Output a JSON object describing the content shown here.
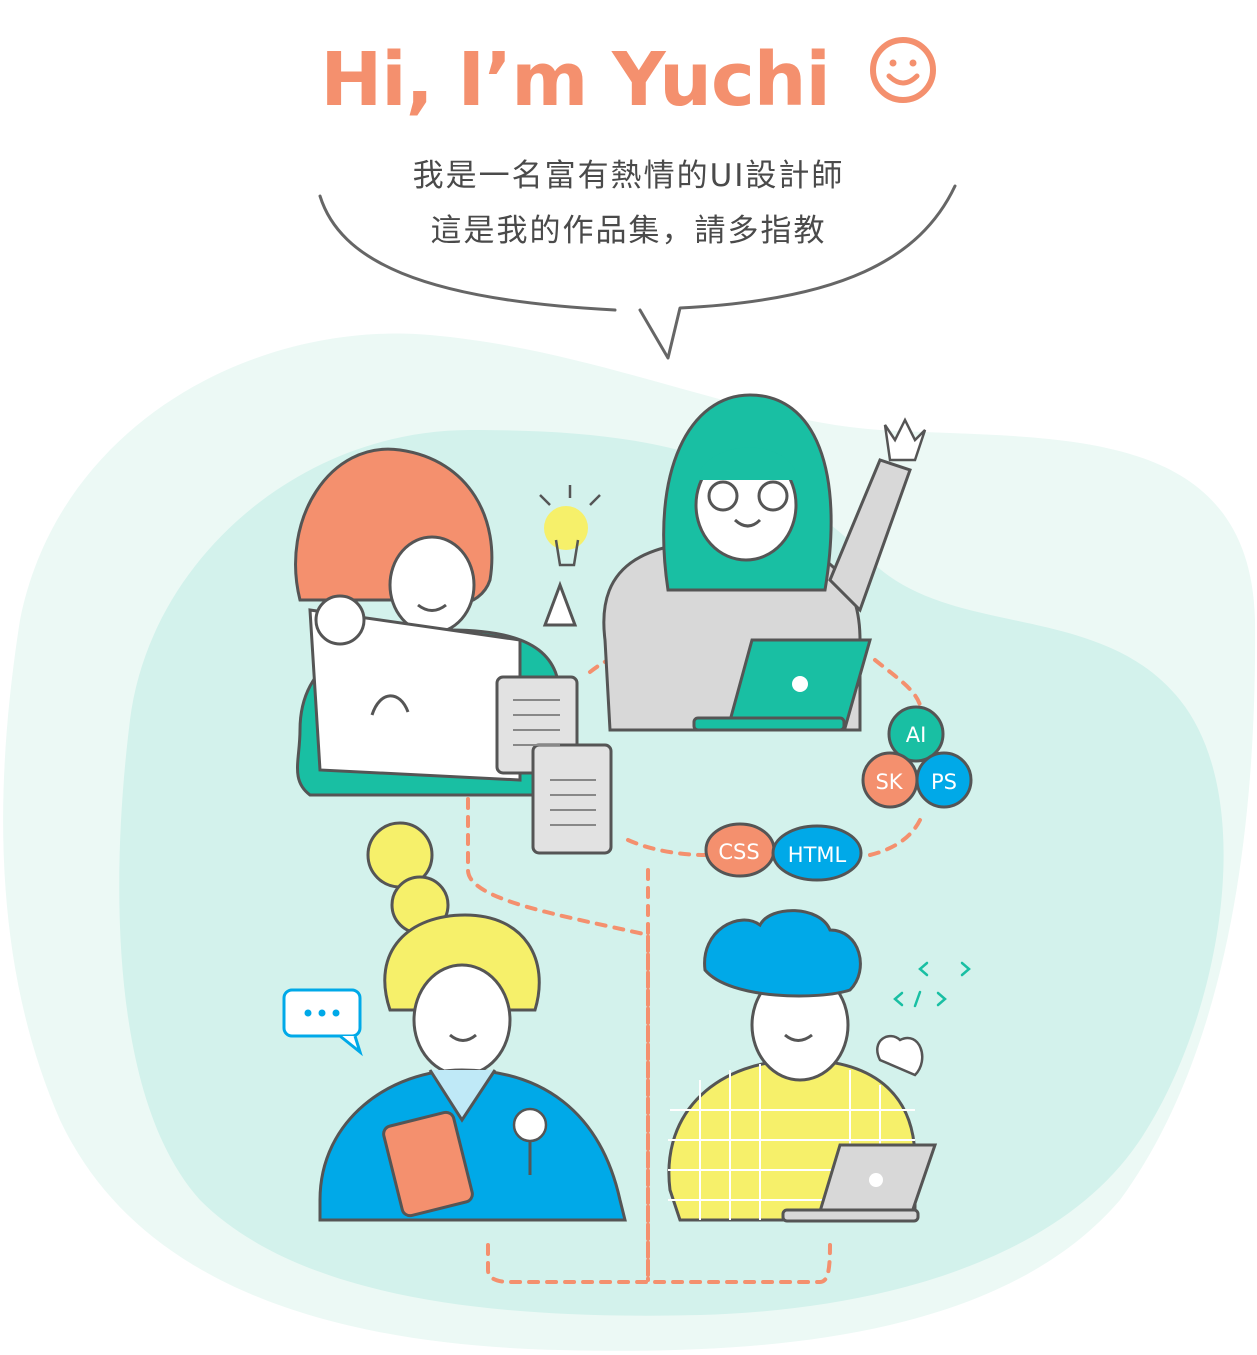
{
  "hero": {
    "title": "Hi, I’m Yuchi",
    "intro_line_1": "我是一名富有熱情的UI設計師",
    "intro_line_2": "這是我的作品集，請多指教",
    "smiley_icon": "smiley-face-icon"
  },
  "skills": {
    "ai": "AI",
    "sk": "SK",
    "ps": "PS",
    "css": "CSS",
    "html": "HTML"
  },
  "colors": {
    "accent": "#f4906e",
    "teal": "#19bfa3",
    "blue": "#00a9e8",
    "yellow": "#f6f06a",
    "mint_bg": "#d3f2ec",
    "outline": "#4a4a4a"
  },
  "illustration": {
    "icons": [
      "lightbulb-icon",
      "document-icon",
      "laptop-icon",
      "chat-bubble-icon",
      "code-brackets-icon",
      "microphone-icon",
      "tablet-icon"
    ]
  }
}
